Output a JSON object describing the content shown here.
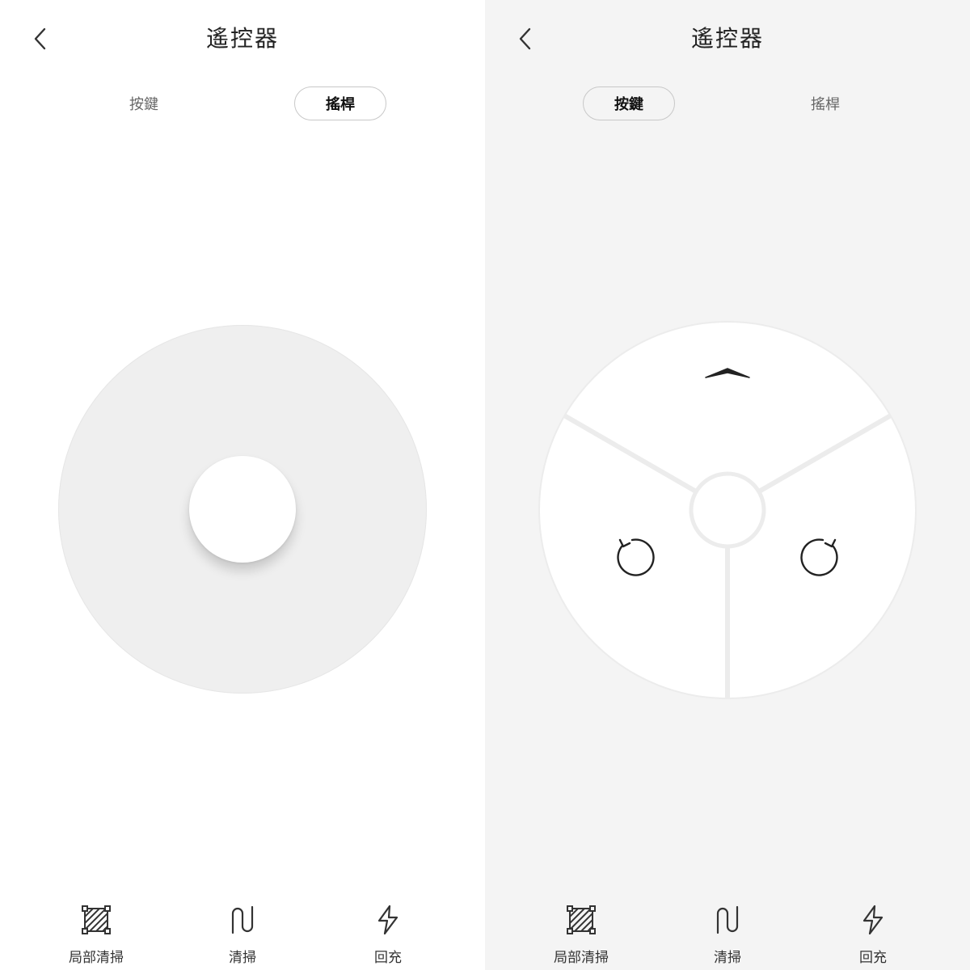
{
  "left": {
    "title": "遙控器",
    "tabs": [
      {
        "label": "按鍵",
        "active": false
      },
      {
        "label": "搖桿",
        "active": true
      }
    ],
    "mode": "joystick",
    "bottom": [
      {
        "label": "局部清掃",
        "icon": "zone-clean-icon"
      },
      {
        "label": "清掃",
        "icon": "clean-path-icon"
      },
      {
        "label": "回充",
        "icon": "recharge-icon"
      }
    ]
  },
  "right": {
    "title": "遙控器",
    "tabs": [
      {
        "label": "按鍵",
        "active": true
      },
      {
        "label": "搖桿",
        "active": false
      }
    ],
    "mode": "buttons",
    "pad_icons": [
      "up-chevron-icon",
      "rotate-left-icon",
      "rotate-right-icon"
    ],
    "bottom": [
      {
        "label": "局部清掃",
        "icon": "zone-clean-icon"
      },
      {
        "label": "清掃",
        "icon": "clean-path-icon"
      },
      {
        "label": "回充",
        "icon": "recharge-icon"
      }
    ]
  },
  "colors": {
    "left_bg": "#ffffff",
    "right_bg": "#f4f4f4",
    "ring": "#efefef",
    "text": "#222222"
  }
}
